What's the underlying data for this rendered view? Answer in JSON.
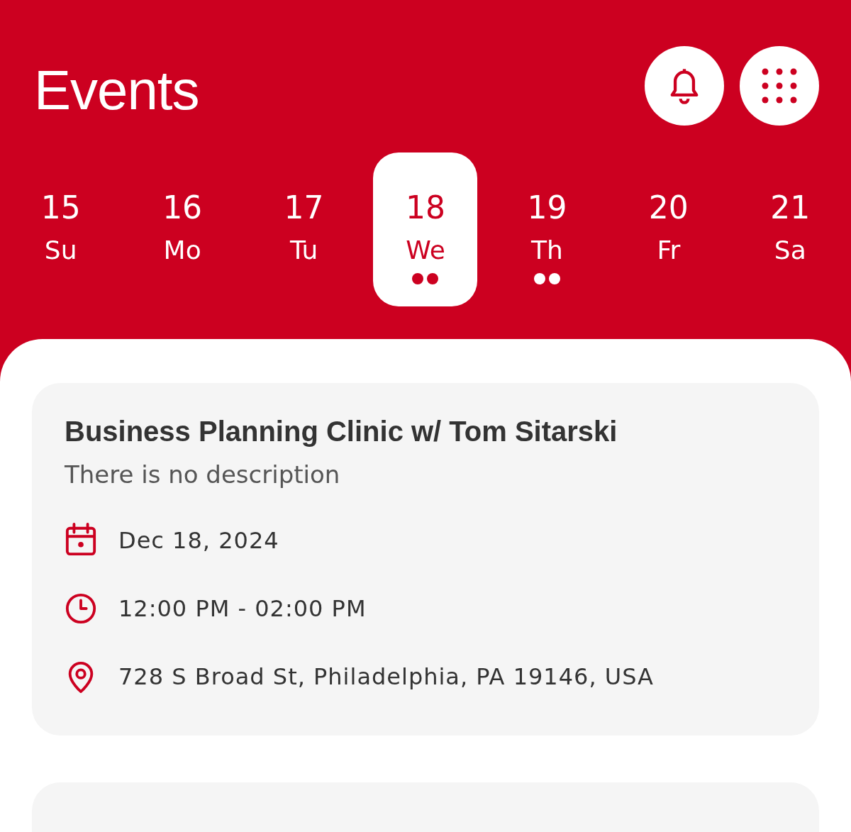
{
  "header": {
    "title": "Events"
  },
  "days": [
    {
      "number": "15",
      "name": "Su",
      "selected": false,
      "has_events": false
    },
    {
      "number": "16",
      "name": "Mo",
      "selected": false,
      "has_events": false
    },
    {
      "number": "17",
      "name": "Tu",
      "selected": false,
      "has_events": false
    },
    {
      "number": "18",
      "name": "We",
      "selected": true,
      "has_events": true
    },
    {
      "number": "19",
      "name": "Th",
      "selected": false,
      "has_events": true
    },
    {
      "number": "20",
      "name": "Fr",
      "selected": false,
      "has_events": false
    },
    {
      "number": "21",
      "name": "Sa",
      "selected": false,
      "has_events": false
    }
  ],
  "events": [
    {
      "title": "Business Planning Clinic w/ Tom Sitarski",
      "description": "There is no description",
      "date": "Dec 18, 2024",
      "time": "12:00 PM - 02:00 PM",
      "location": "728 S Broad St, Philadelphia, PA 19146, USA"
    }
  ],
  "more_cards_below": true
}
